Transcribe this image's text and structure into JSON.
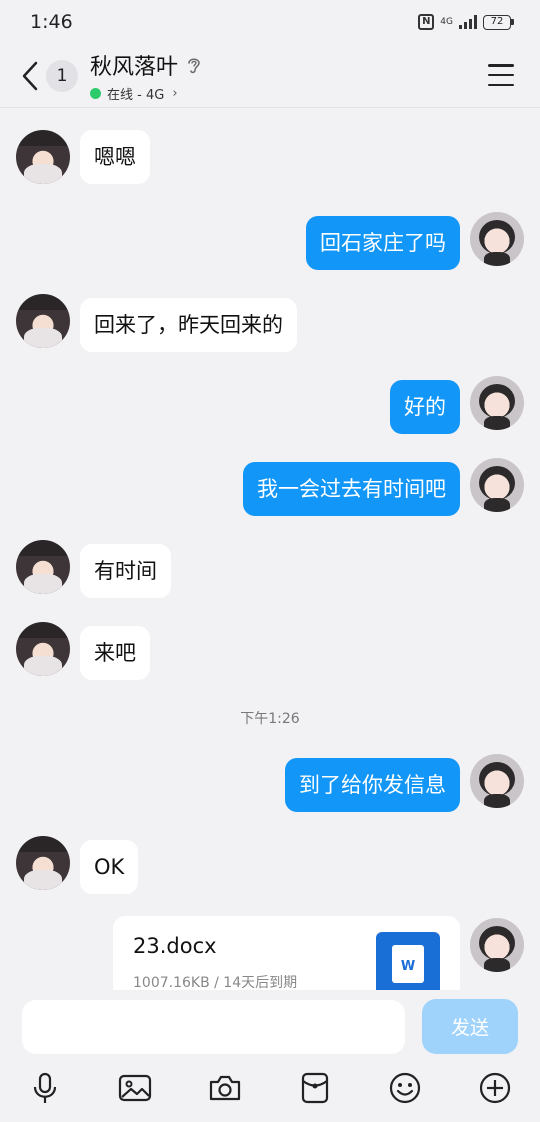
{
  "status_bar": {
    "time": "1:46",
    "network": "4G",
    "battery": "72"
  },
  "header": {
    "unread_count": "1",
    "contact_name": "秋风落叶",
    "presence": "在线 - 4G"
  },
  "messages": [
    {
      "side": "left",
      "text": "嗯嗯"
    },
    {
      "side": "right",
      "text": "回石家庄了吗"
    },
    {
      "side": "left",
      "text": "回来了，昨天回来的"
    },
    {
      "side": "right",
      "text": "好的"
    },
    {
      "side": "right",
      "text": "我一会过去有时间吧"
    },
    {
      "side": "left",
      "text": "有时间"
    },
    {
      "side": "left",
      "text": "来吧"
    },
    {
      "side": "right",
      "text": "到了给你发信息"
    },
    {
      "side": "left",
      "text": "OK"
    }
  ],
  "time_separator": "下午1:26",
  "file": {
    "name": "23.docx",
    "meta": "1007.16KB / 14天后到期",
    "icon_letter": "W"
  },
  "composer": {
    "placeholder": "",
    "send_label": "发送"
  },
  "colors": {
    "outgoing_bubble": "#1296f7",
    "send_disabled": "#9fd3fb",
    "online": "#2bcb6c"
  }
}
